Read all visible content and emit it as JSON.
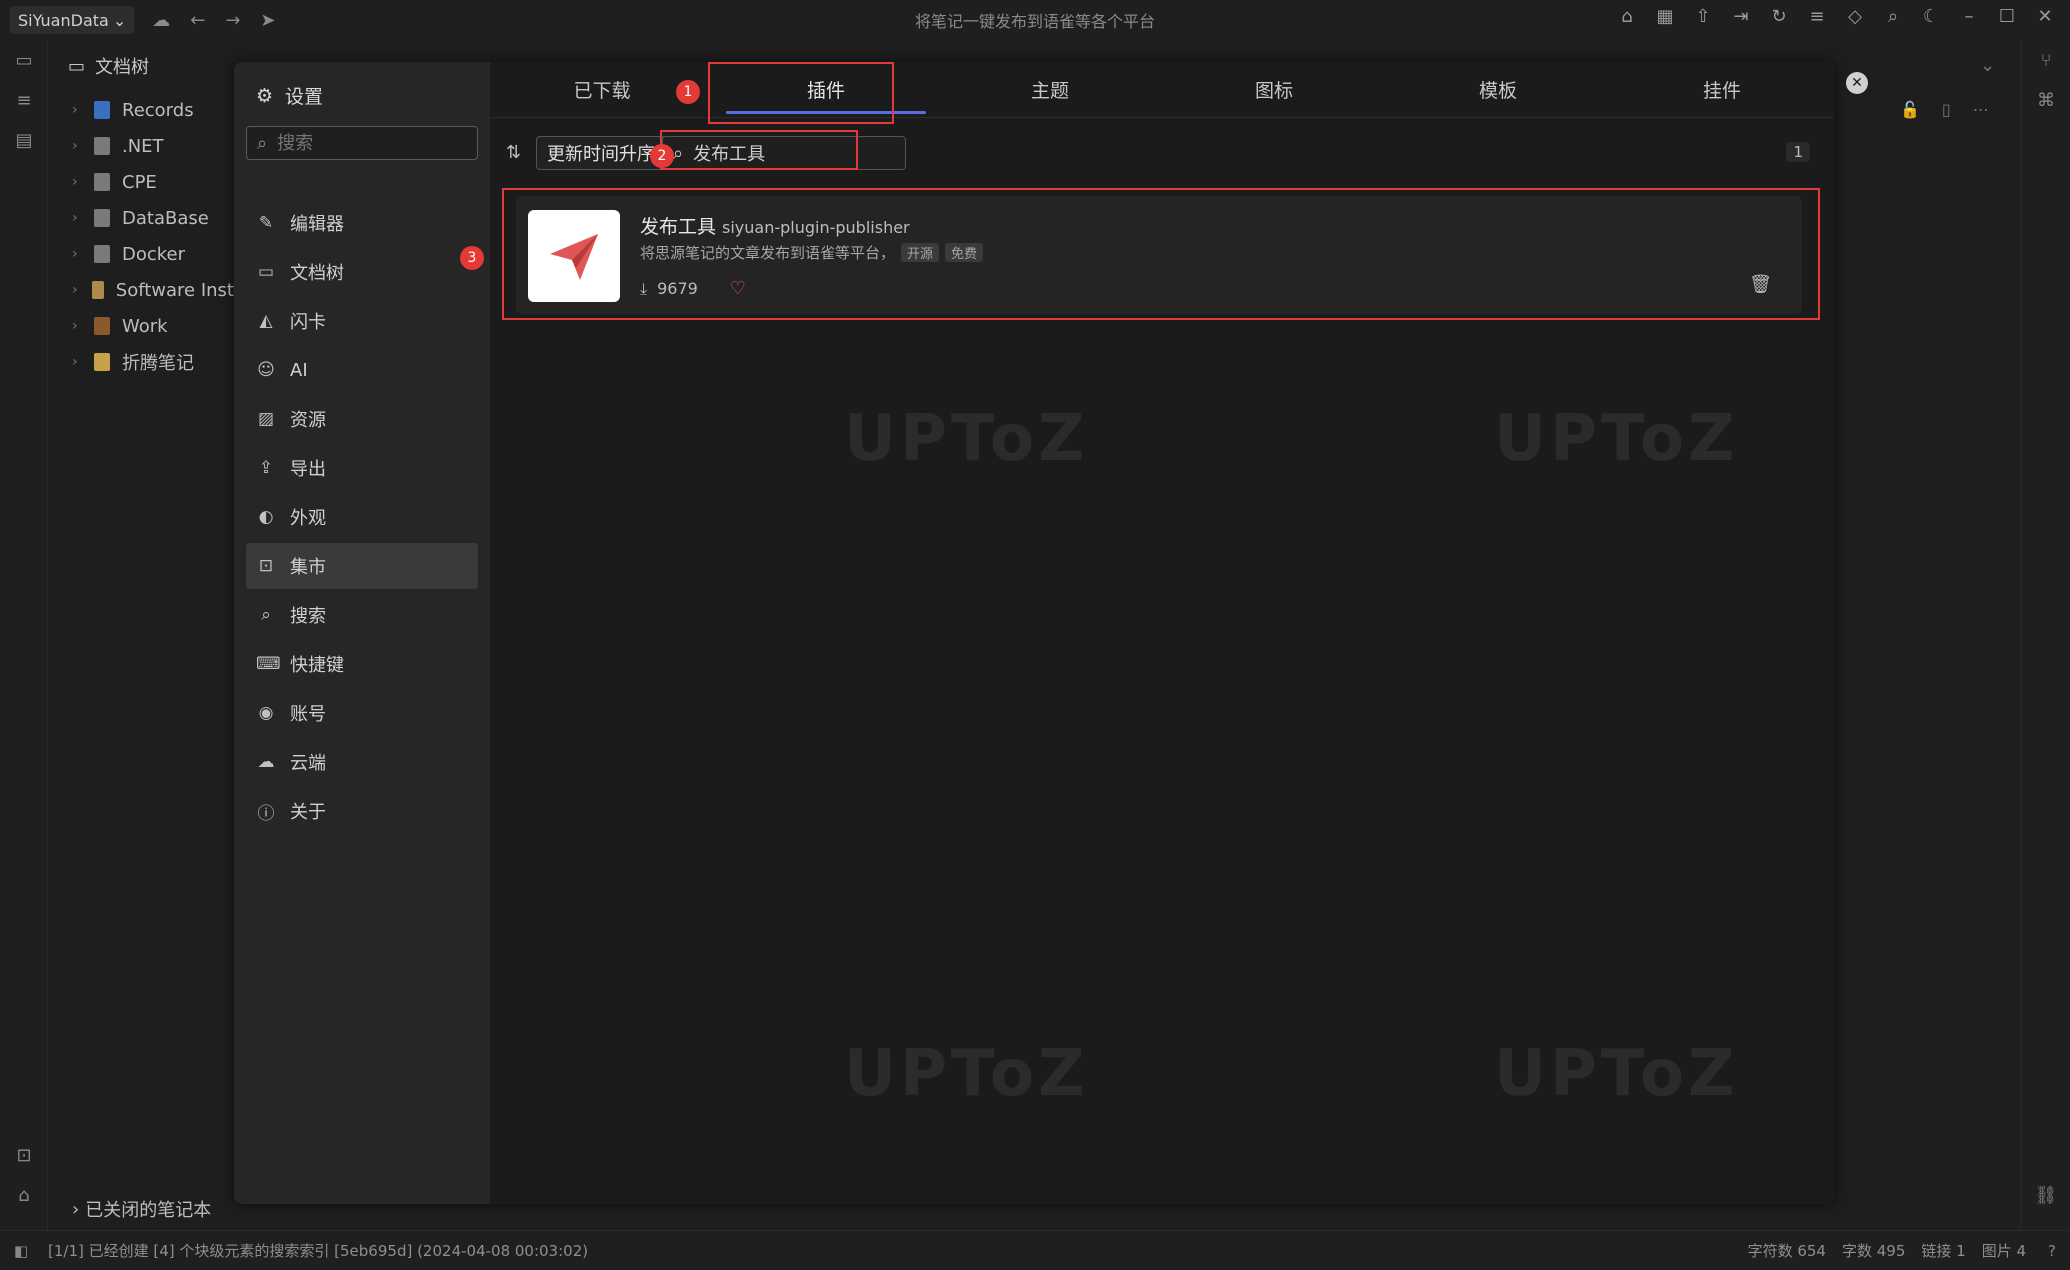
{
  "titlebar": {
    "workspace": "SiYuanData",
    "window_title": "将笔记一键发布到语雀等各个平台"
  },
  "filetree": {
    "header": "文档树",
    "notebooks": [
      {
        "label": "Records",
        "color": "#3b6fbf"
      },
      {
        "label": ".NET",
        "color": "#7a7a7a"
      },
      {
        "label": "CPE",
        "color": "#7a7a7a"
      },
      {
        "label": "DataBase",
        "color": "#7a7a7a"
      },
      {
        "label": "Docker",
        "color": "#7a7a7a"
      },
      {
        "label": "Software Inst",
        "color": "#b08a4a"
      },
      {
        "label": "Work",
        "color": "#8a5a2a"
      },
      {
        "label": "折腾笔记",
        "color": "#c9a04a"
      }
    ],
    "closed_notebooks": "已关闭的笔记本"
  },
  "settings": {
    "title": "设置",
    "search_placeholder": "搜索",
    "menu": [
      {
        "label": "编辑器",
        "icon": "edit-icon"
      },
      {
        "label": "文档树",
        "icon": "folder-icon"
      },
      {
        "label": "闪卡",
        "icon": "flashcard-icon"
      },
      {
        "label": "AI",
        "icon": "robot-icon"
      },
      {
        "label": "资源",
        "icon": "image-icon"
      },
      {
        "label": "导出",
        "icon": "upload-icon"
      },
      {
        "label": "外观",
        "icon": "palette-icon"
      },
      {
        "label": "集市",
        "icon": "bazaar-icon",
        "active": true
      },
      {
        "label": "搜索",
        "icon": "search-icon"
      },
      {
        "label": "快捷键",
        "icon": "keyboard-icon"
      },
      {
        "label": "账号",
        "icon": "account-icon"
      },
      {
        "label": "云端",
        "icon": "cloud-icon"
      },
      {
        "label": "关于",
        "icon": "info-icon"
      }
    ]
  },
  "bazaar": {
    "tabs": [
      {
        "label": "已下载",
        "active": false
      },
      {
        "label": "插件",
        "active": true
      },
      {
        "label": "主题",
        "active": false
      },
      {
        "label": "图标",
        "active": false
      },
      {
        "label": "模板",
        "active": false
      },
      {
        "label": "挂件",
        "active": false
      }
    ],
    "sort_label": "更新时间升序",
    "search_value": "发布工具",
    "result_count": "1",
    "plugin": {
      "name": "发布工具",
      "package": "siyuan-plugin-publisher",
      "description": "将思源笔记的文章发布到语雀等平台，",
      "tags": [
        "开源",
        "免费"
      ],
      "downloads": "9679"
    }
  },
  "annotations": [
    "1",
    "2",
    "3"
  ],
  "statusbar": {
    "message": "[1/1] 已经创建 [4] 个块级元素的搜索索引 [5eb695d] (2024-04-08 00:03:02)",
    "stats": [
      "字符数 654",
      "字数 495",
      "链接 1",
      "图片 4"
    ]
  },
  "watermark": "UPToZ",
  "colors": {
    "accent": "#5b6ee1",
    "highlight": "#e03a3a",
    "heart": "#d84aa6"
  }
}
